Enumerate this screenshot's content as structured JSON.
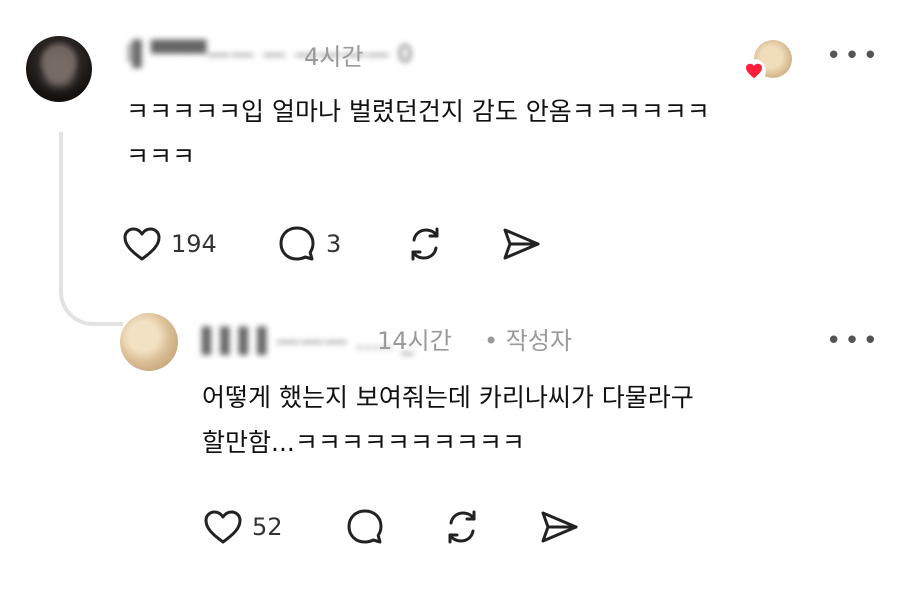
{
  "main_comment": {
    "username": "l▌▀▀▀—— — ————",
    "username_suffix": "0",
    "time": "4시간",
    "text_line1": "ㅋㅋㅋㅋㅋ입 얼마나 벌렸던건지 감도 안옴ㅋㅋㅋㅋㅋㅋ",
    "text_line2": "ㅋㅋㅋ",
    "likes": "194",
    "replies": "3"
  },
  "reply_comment": {
    "username": "▌▌▌▌——— .....",
    "username_suffix": "_",
    "time": "14시간",
    "author_badge": "• 작성자",
    "text_line1": "어떻게 했는지 보여줘는데 카리나씨가 다물라구",
    "text_line2": "할만함...ㅋㅋㅋㅋㅋㅋㅋㅋㅋㅋ",
    "likes": "52"
  },
  "more_label": "•••",
  "icons": {
    "like": "heart-outline-icon",
    "reply": "speech-bubble-icon",
    "repost": "repost-icon",
    "share": "paper-plane-icon",
    "liked": "red-heart-icon"
  },
  "colors": {
    "text": "#111111",
    "meta": "#9a9a9a",
    "heart": "#ff1f3d",
    "line": "#e2e2e2"
  }
}
